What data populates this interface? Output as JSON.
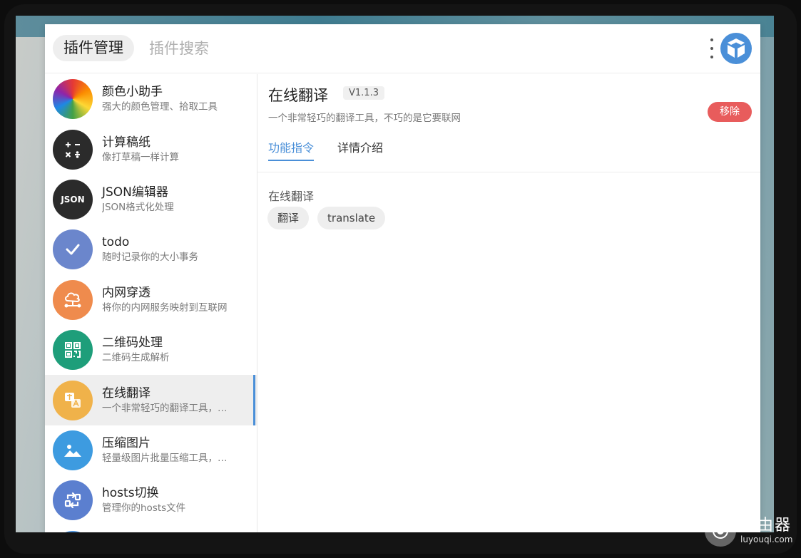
{
  "header": {
    "manage_label": "插件管理",
    "search_placeholder": "插件搜索"
  },
  "sidebar": {
    "items": [
      {
        "title": "颜色小助手",
        "desc": "强大的颜色管理、拾取工具",
        "icon": "color-wheel-icon"
      },
      {
        "title": "计算稿纸",
        "desc": "像打草稿一样计算",
        "icon": "calculator-icon"
      },
      {
        "title": "JSON编辑器",
        "desc": "JSON格式化处理",
        "icon": "json-icon",
        "icon_text": "JSON"
      },
      {
        "title": "todo",
        "desc": "随时记录你的大小事务",
        "icon": "check-icon"
      },
      {
        "title": "内网穿透",
        "desc": "将你的内网服务映射到互联网",
        "icon": "cloud-network-icon"
      },
      {
        "title": "二维码处理",
        "desc": "二维码生成解析",
        "icon": "qrcode-icon"
      },
      {
        "title": "在线翻译",
        "desc": "一个非常轻巧的翻译工具，…",
        "icon": "translate-icon",
        "active": true
      },
      {
        "title": "压缩图片",
        "desc": "轻量级图片批量压缩工具，…",
        "icon": "image-icon"
      },
      {
        "title": "hosts切换",
        "desc": "管理你的hosts文件",
        "icon": "switch-icon"
      }
    ]
  },
  "main": {
    "title": "在线翻译",
    "version": "V1.1.3",
    "desc": "一个非常轻巧的翻译工具，不巧的是它要联网",
    "remove_label": "移除",
    "tabs": [
      {
        "label": "功能指令",
        "active": true
      },
      {
        "label": "详情介绍",
        "active": false
      }
    ],
    "section_title": "在线翻译",
    "commands": [
      "翻译",
      "translate"
    ]
  },
  "watermark": {
    "title": "路由器",
    "sub": "luyouqi.com"
  },
  "colors": {
    "accent": "#4a8fd8",
    "danger": "#e85c5c",
    "todo": "#6b86cc",
    "network": "#ef8b4d",
    "qrcode": "#1e9e7a",
    "translate": "#f0b24a",
    "image": "#3d9be0",
    "hosts": "#5b7fcf",
    "dark": "#2b2b2b"
  }
}
